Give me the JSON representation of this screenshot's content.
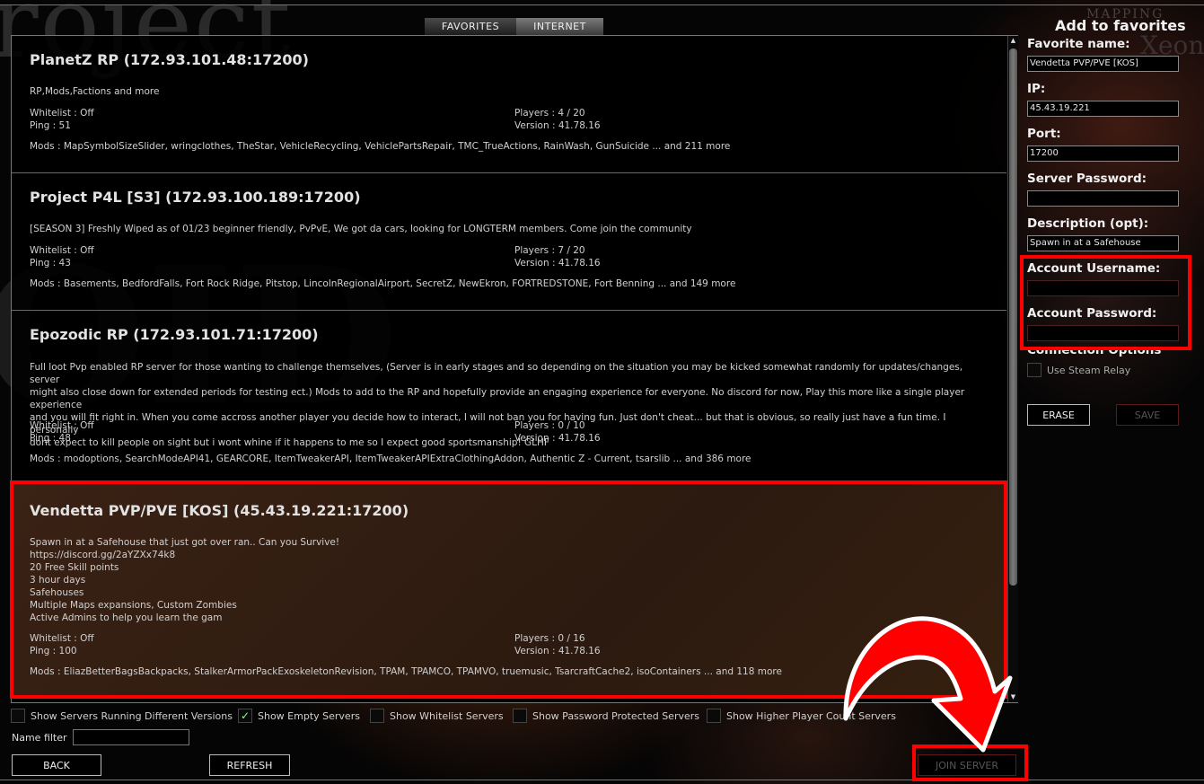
{
  "tabs": [
    {
      "label": "FAVORITES",
      "active": false
    },
    {
      "label": "INTERNET",
      "active": true
    }
  ],
  "servers": [
    {
      "title": "PlanetZ RP (172.93.101.48:17200)",
      "description": "RP,Mods,Factions and more",
      "whitelist": "Whitelist : Off",
      "ping": "Ping : 51",
      "players": "Players : 4 / 20",
      "version": "Version : 41.78.16",
      "mods": "Mods : MapSymbolSizeSlider, wringclothes, TheStar, VehicleRecycling, VehiclePartsRepair, TMC_TrueActions, RainWash, GunSuicide ... and 211 more",
      "selected": false
    },
    {
      "title": "Project P4L [S3] (172.93.100.189:17200)",
      "description": "[SEASON 3] Freshly Wiped as of 01/23 beginner friendly, PvPvE, We got da cars, looking for LONGTERM members. Come join the community",
      "whitelist": "Whitelist : Off",
      "ping": "Ping : 43",
      "players": "Players : 7 / 20",
      "version": "Version : 41.78.16",
      "mods": "Mods : Basements, BedfordFalls, Fort Rock Ridge, Pitstop, LincolnRegionalAirport, SecretZ, NewEkron, FORTREDSTONE, Fort Benning ... and 149 more",
      "selected": false
    },
    {
      "title": "Epozodic RP (172.93.101.71:17200)",
      "description": "Full loot Pvp enabled RP server for those wanting to challenge themselves, (Server is in early stages and so depending on the situation you may be kicked somewhat randomly for updates/changes, server\nmight also close down for extended periods for testing ect.) Mods to add to the RP and hopefully provide an engaging experience for everyone. No discord for now, Play this more like a single player experience\nand you will fit right in. When you come accross another player you decide how to interact, I will not ban you for having fun. Just don't cheat... but that is obvious, so really just have a fun time. I personally\ndont expect to kill people on sight but i wont whine if it happens to me so I expect good sportsmanship! GLHF",
      "whitelist": "Whitelist : Off",
      "ping": "Ping : 48",
      "players": "Players : 0 / 10",
      "version": "Version : 41.78.16",
      "mods": "Mods : modoptions, SearchModeAPI41, GEARCORE, ItemTweakerAPI, ItemTweakerAPIExtraClothingAddon, Authentic Z - Current, tsarslib ... and 386 more",
      "selected": false
    },
    {
      "title": "Vendetta PVP/PVE [KOS] (45.43.19.221:17200)",
      "description": "Spawn in at a Safehouse that just got over ran.. Can you Survive!\nhttps://discord.gg/2aYZXx74k8\n20 Free Skill points\n3 hour days\nSafehouses\nMultiple Maps expansions, Custom Zombies\nActive Admins to help you learn the gam",
      "whitelist": "Whitelist : Off",
      "ping": "Ping : 100",
      "players": "Players : 0 / 16",
      "version": "Version : 41.78.16",
      "mods": "Mods : EliazBetterBagsBackpacks, StalkerArmorPackExoskeletonRevision, TPAM, TPAMCO, TPAMVO, truemusic, TsarcraftCache2, isoContainers ... and 118 more",
      "selected": true
    }
  ],
  "filters": [
    {
      "label": "Show Servers Running Different Versions",
      "checked": false
    },
    {
      "label": "Show Empty Servers",
      "checked": true
    },
    {
      "label": "Show Whitelist Servers",
      "checked": false
    },
    {
      "label": "Show Password Protected Servers",
      "checked": false
    },
    {
      "label": "Show Higher Player Count Servers",
      "checked": false
    }
  ],
  "name_filter": {
    "label": "Name filter",
    "value": ""
  },
  "buttons": {
    "back": "BACK",
    "refresh": "REFRESH",
    "join": "JOIN SERVER"
  },
  "favorites_panel": {
    "heading": "Add to favorites",
    "favorite_name_label": "Favorite name:",
    "favorite_name_value": "Vendetta PVP/PVE [KOS]",
    "ip_label": "IP:",
    "ip_value": "45.43.19.221",
    "port_label": "Port:",
    "port_value": "17200",
    "server_password_label": "Server Password:",
    "server_password_value": "",
    "description_label": "Description (opt):",
    "description_value": "Spawn in at a Safehouse",
    "account_username_label": "Account Username:",
    "account_username_value": "",
    "account_password_label": "Account Password:",
    "account_password_value": "",
    "connection_options_label": "Connection Options",
    "steam_relay_label": "Use Steam Relay",
    "steam_relay_checked": false,
    "erase_label": "ERASE",
    "save_label": "SAVE"
  },
  "background": {
    "logo_text": "roject",
    "logo_text2": "OID",
    "credit_small": "MAPPING",
    "credit_large": "Xeony"
  },
  "colors": {
    "highlight": "#ff0000",
    "selected_row": "#2c1a10",
    "panel_bg": "#000000"
  },
  "scrollbar": {
    "position_fraction": 0.0,
    "visible_fraction": 0.8
  }
}
